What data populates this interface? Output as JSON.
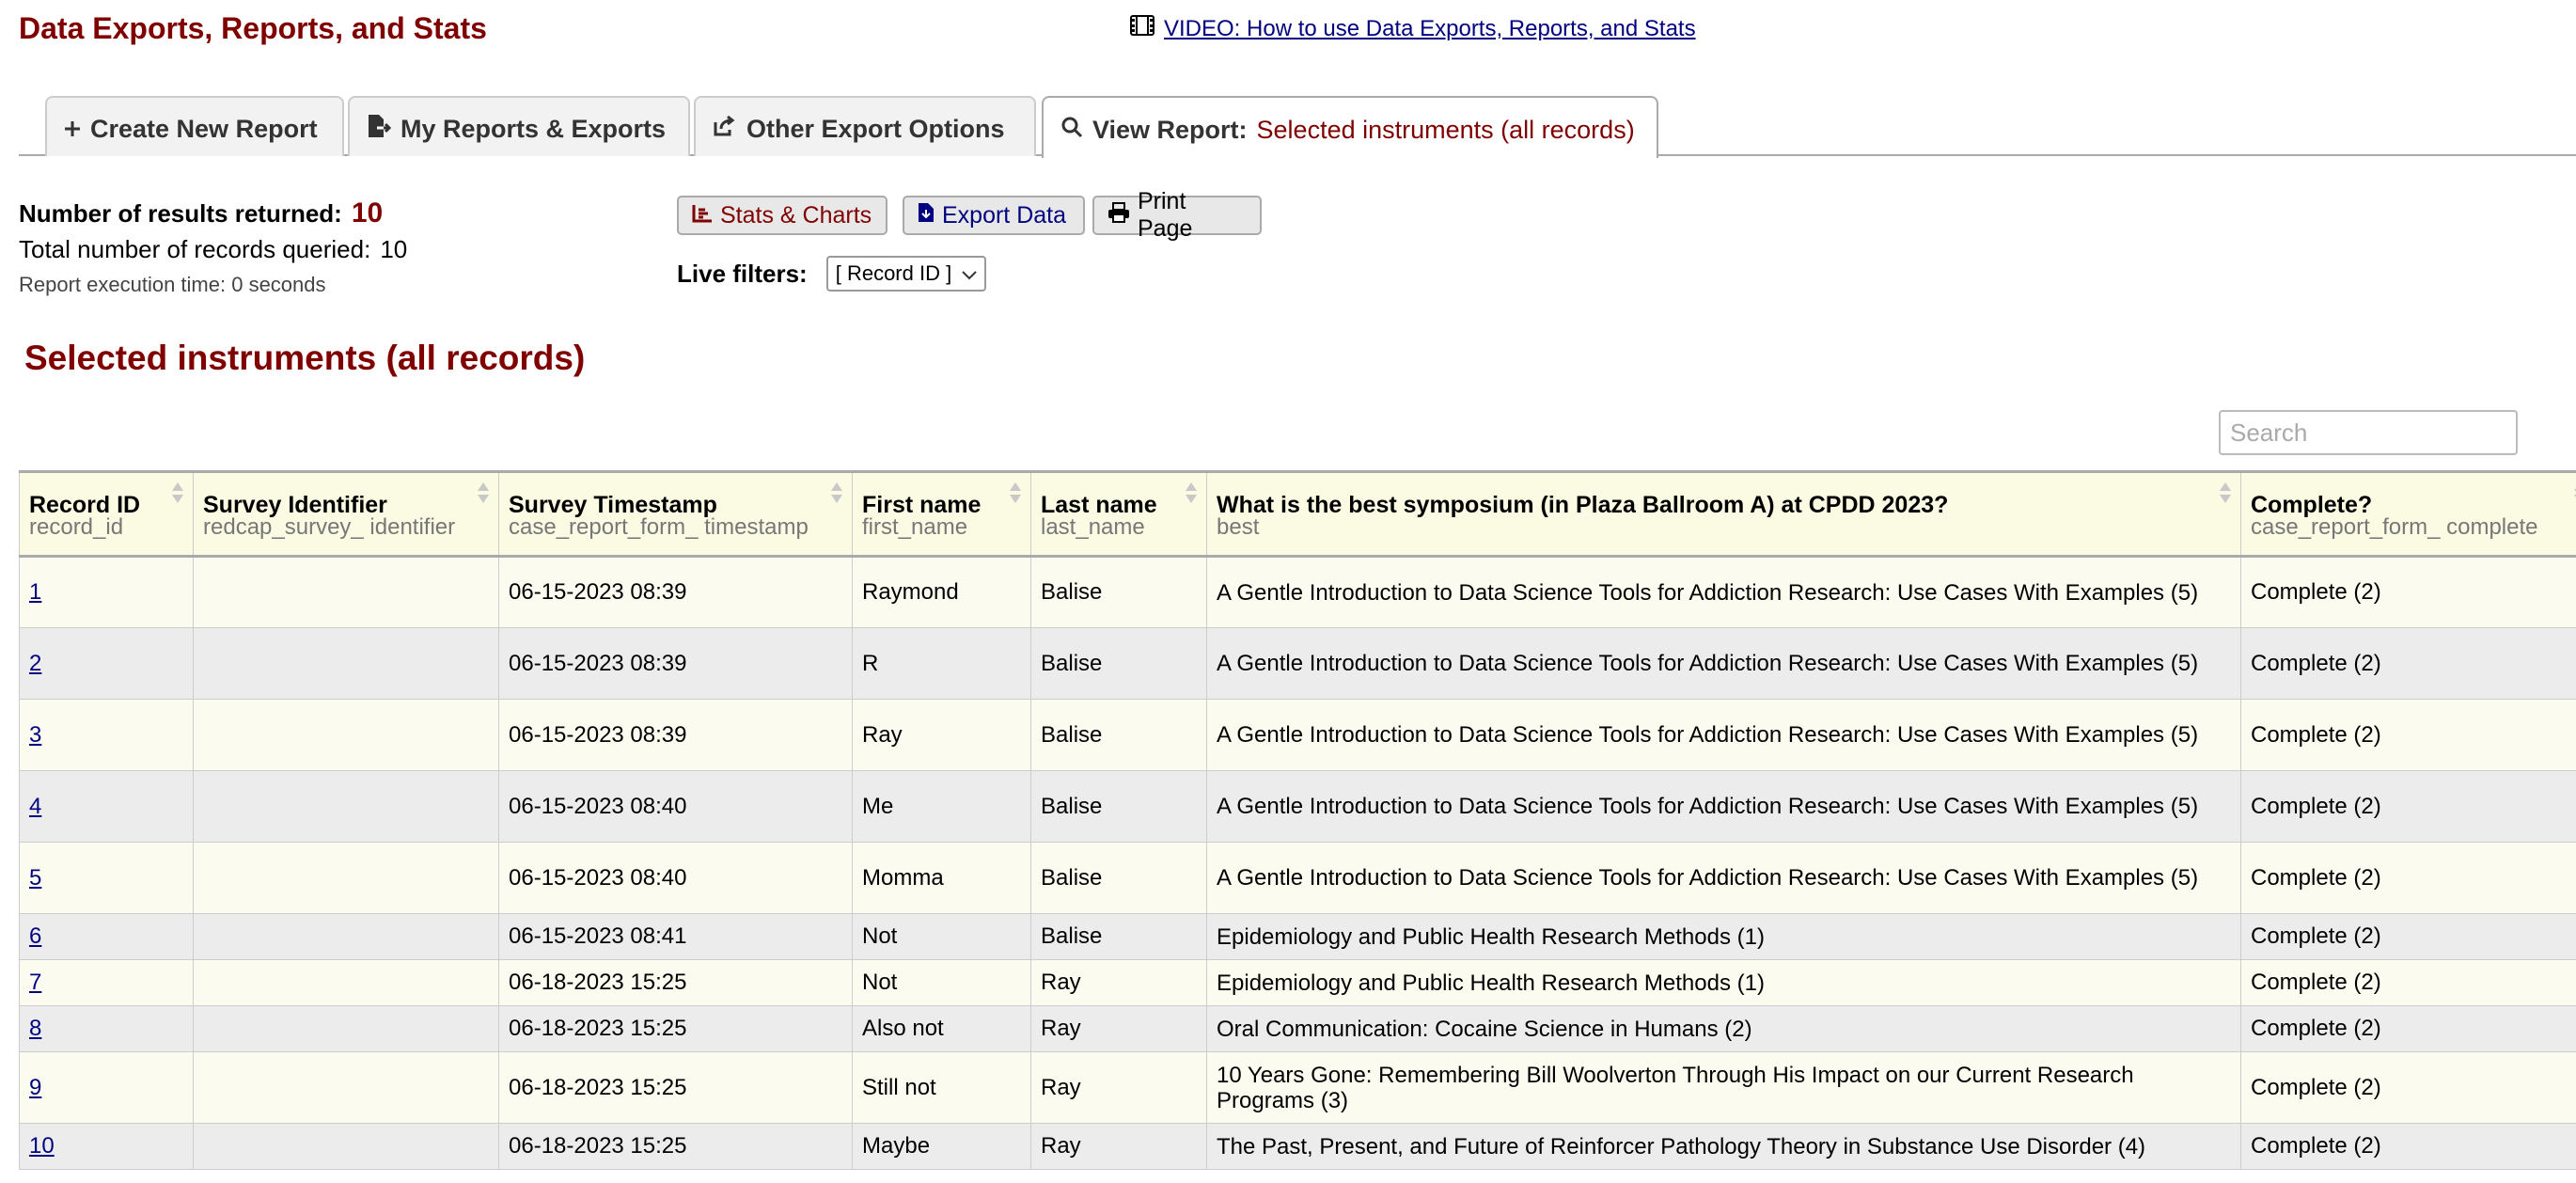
{
  "page_title": "Data Exports, Reports, and Stats",
  "video_link": {
    "icon": "film-icon",
    "label": "VIDEO: How to use Data Exports, Reports, and Stats"
  },
  "tabs": [
    {
      "icon": "plus-icon",
      "label": "Create New Report"
    },
    {
      "icon": "file-export-icon",
      "label": "My Reports & Exports"
    },
    {
      "icon": "share-icon",
      "label": "Other Export Options"
    },
    {
      "icon": "search-icon",
      "label": "View Report:",
      "sub": "Selected instruments (all records)",
      "active": true
    }
  ],
  "summary": {
    "results_label": "Number of results returned:",
    "results_value": "10",
    "total_label": "Total number of records queried:",
    "total_value": "10",
    "execution": "Report execution time: 0 seconds"
  },
  "buttons": {
    "stats": {
      "icon": "chart-icon",
      "label": "Stats & Charts",
      "color": "#800000"
    },
    "export": {
      "icon": "file-download-icon",
      "label": "Export Data",
      "color": "#000080"
    },
    "print": {
      "icon": "printer-icon",
      "label": "Print Page",
      "color": "#000000"
    }
  },
  "filters": {
    "label": "Live filters:",
    "selected": "[ Record ID ]"
  },
  "report_title": "Selected instruments (all records)",
  "search": {
    "placeholder": "Search",
    "value": ""
  },
  "table": {
    "columns": [
      {
        "label": "Record ID",
        "var": "record_id"
      },
      {
        "label": "Survey Identifier",
        "var": "redcap_survey_ identifier"
      },
      {
        "label": "Survey Timestamp",
        "var": "case_report_form_ timestamp"
      },
      {
        "label": "First name",
        "var": "first_name"
      },
      {
        "label": "Last name",
        "var": "last_name"
      },
      {
        "label": "What is the best symposium (in Plaza Ballroom A) at CPDD 2023?",
        "var": "best"
      },
      {
        "label": "Complete?",
        "var": "case_report_form_ complete"
      }
    ],
    "rows": [
      {
        "record_id": "1",
        "survey_identifier": "",
        "timestamp": "06-15-2023 08:39",
        "first_name": "Raymond",
        "last_name": "Balise",
        "best": "A Gentle Introduction to Data Science Tools for Addiction Research: Use Cases With Examples (5)",
        "complete": "Complete (2)"
      },
      {
        "record_id": "2",
        "survey_identifier": "",
        "timestamp": "06-15-2023 08:39",
        "first_name": "R",
        "last_name": "Balise",
        "best": "A Gentle Introduction to Data Science Tools for Addiction Research: Use Cases With Examples (5)",
        "complete": "Complete (2)"
      },
      {
        "record_id": "3",
        "survey_identifier": "",
        "timestamp": "06-15-2023 08:39",
        "first_name": "Ray",
        "last_name": "Balise",
        "best": "A Gentle Introduction to Data Science Tools for Addiction Research: Use Cases With Examples (5)",
        "complete": "Complete (2)"
      },
      {
        "record_id": "4",
        "survey_identifier": "",
        "timestamp": "06-15-2023 08:40",
        "first_name": "Me",
        "last_name": "Balise",
        "best": "A Gentle Introduction to Data Science Tools for Addiction Research: Use Cases With Examples (5)",
        "complete": "Complete (2)"
      },
      {
        "record_id": "5",
        "survey_identifier": "",
        "timestamp": "06-15-2023 08:40",
        "first_name": "Momma",
        "last_name": "Balise",
        "best": "A Gentle Introduction to Data Science Tools for Addiction Research: Use Cases With Examples (5)",
        "complete": "Complete (2)"
      },
      {
        "record_id": "6",
        "survey_identifier": "",
        "timestamp": "06-15-2023 08:41",
        "first_name": "Not",
        "last_name": "Balise",
        "best": "Epidemiology and Public Health Research Methods (1)",
        "complete": "Complete (2)"
      },
      {
        "record_id": "7",
        "survey_identifier": "",
        "timestamp": "06-18-2023 15:25",
        "first_name": "Not",
        "last_name": "Ray",
        "best": "Epidemiology and Public Health Research Methods (1)",
        "complete": "Complete (2)"
      },
      {
        "record_id": "8",
        "survey_identifier": "",
        "timestamp": "06-18-2023 15:25",
        "first_name": "Also not",
        "last_name": "Ray",
        "best": "Oral Communication: Cocaine Science in Humans (2)",
        "complete": "Complete (2)"
      },
      {
        "record_id": "9",
        "survey_identifier": "",
        "timestamp": "06-18-2023 15:25",
        "first_name": "Still not",
        "last_name": "Ray",
        "best": "10 Years Gone: Remembering Bill Woolverton Through His Impact on our Current Research Programs (3)",
        "complete": "Complete (2)"
      },
      {
        "record_id": "10",
        "survey_identifier": "",
        "timestamp": "06-18-2023 15:25",
        "first_name": "Maybe",
        "last_name": "Ray",
        "best": "The Past, Present, and Future of Reinforcer Pathology Theory in Substance Use Disorder (4)",
        "complete": "Complete (2)"
      }
    ]
  },
  "colors": {
    "brand": "#800000",
    "link": "#000080",
    "header_bg": "#fbfbe3",
    "row_odd": "#fbfbf0",
    "row_even": "#ececec"
  }
}
